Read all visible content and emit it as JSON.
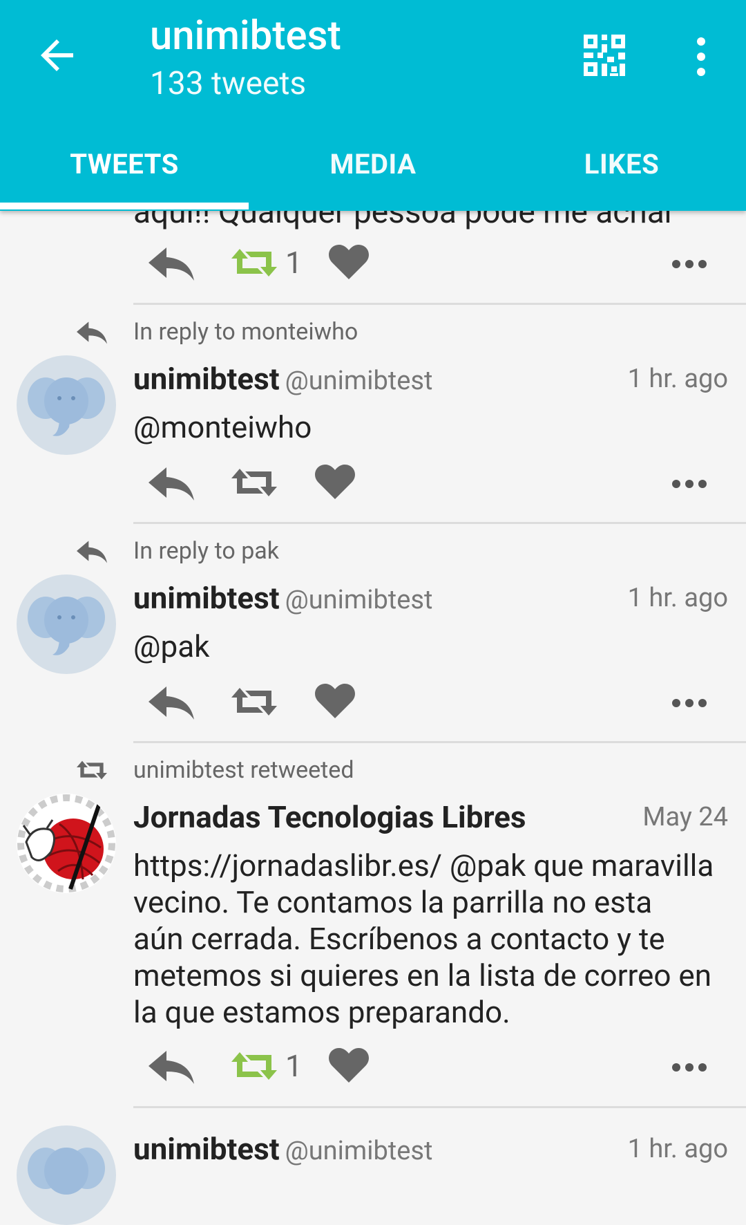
{
  "appbar": {
    "title": "unimibtest",
    "subtitle": "133 tweets",
    "back_icon": "arrow-left-icon",
    "qr_icon": "qr-code-icon",
    "menu_icon": "more-vert-icon",
    "color": "#00bcd4"
  },
  "tabs": [
    {
      "label": "TWEETS",
      "selected": true
    },
    {
      "label": "MEDIA",
      "selected": false
    },
    {
      "label": "LIKES",
      "selected": false
    }
  ],
  "feed": {
    "partial_tweet": {
      "text": "aqui!! Qualquer pessoa pode me achar",
      "retweet_count": "1"
    },
    "tweets": [
      {
        "context": "In reply to monteiwho",
        "name": "unimibtest",
        "handle": "@unimibtest",
        "time": "1 hr. ago",
        "text": "@monteiwho"
      },
      {
        "context": "In reply to pak",
        "name": "unimibtest",
        "handle": "@unimibtest",
        "time": "1 hr. ago",
        "text": "@pak"
      },
      {
        "context": "unimibtest retweeted",
        "name": "Jornadas Tecnologias Libres",
        "handle": "",
        "time": "May 24",
        "text_lines": [
          "https://jornadaslibr.es/ @pak que maravilla",
          "vecino. Te contamos la parrilla no esta",
          "aún cerrada. Escríbenos a contacto y te",
          "metemos si quieres en la lista de correo en",
          "la que estamos preparando."
        ],
        "retweet_count": "1"
      },
      {
        "name": "unimibtest",
        "handle": "@unimibtest",
        "time": "1 hr. ago"
      }
    ]
  },
  "colors": {
    "retweeted_green": "#8bc34a",
    "icon_gray": "#666666"
  }
}
